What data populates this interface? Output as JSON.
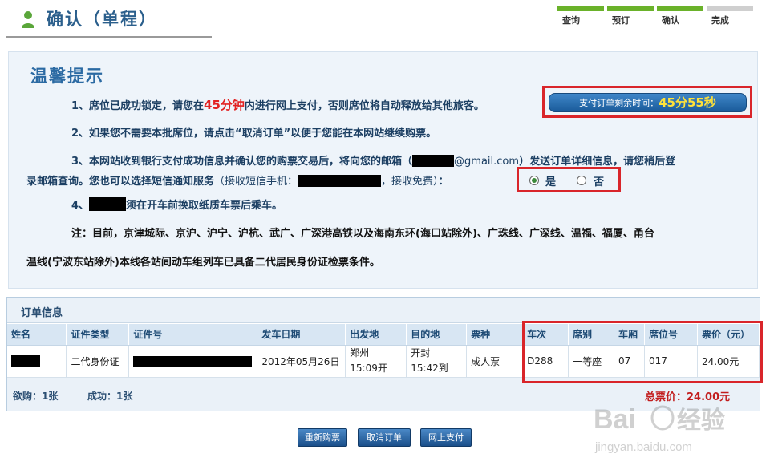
{
  "page": {
    "title": "确认（单程）"
  },
  "steps": [
    {
      "label": "查询",
      "done": true
    },
    {
      "label": "预订",
      "done": true
    },
    {
      "label": "确认",
      "done": true
    },
    {
      "label": "完成",
      "done": false
    }
  ],
  "tips": {
    "heading": "温馨提示",
    "line1_pre": "1、席位已成功锁定，请您在",
    "line1_time": "45分钟",
    "line1_post": "内进行网上支付，否则席位将自动释放给其他旅客。",
    "line2": "2、如果您不需要本批席位，请点击“取消订单”以便于您能在本网站继续购票。",
    "line3a_pre": "3、本网站收到银行支付成功信息并确认您的购票交易后，将向您的邮箱（",
    "line3a_email": "@gmail.com",
    "line3a_post": "）发送订单详细信息，请您稍后登",
    "line3b_pre": "录邮箱查询。您也可以选择短信通知服务",
    "line3b_paren_pre": "（接收短信手机：",
    "line3b_paren_post": "，接收免费）",
    "line3b_end": "：",
    "line4": "须在开车前换取纸质车票后乘车。",
    "line4_pre": "4、",
    "note1": "注：目前，京津城际、京沪、沪宁、沪杭、武广、广深港高铁以及海南东环(海口站除外)、广珠线、广深线、温福、福厦、甬台",
    "note2": "温线(宁波东站除外)本线各站间动车组列车已具备二代居民身份证检票条件。",
    "timer_label": "支付订单剩余时间：",
    "timer_value": "45分55秒",
    "sms_yes": "是",
    "sms_no": "否",
    "sms_selected": "yes"
  },
  "order": {
    "heading": "订单信息",
    "columns": [
      "姓名",
      "证件类型",
      "证件号",
      "发车日期",
      "出发地",
      "目的地",
      "票种",
      "车次",
      "席别",
      "车厢",
      "席位号",
      "票价（元）"
    ],
    "rows": [
      {
        "name": "",
        "id_type": "二代身份证",
        "id_number": "",
        "date": "2012年05月26日",
        "from_station": "郑州",
        "from_time": "15:09开",
        "to_station": "开封",
        "to_time": "15:42到",
        "ticket_type": "成人票",
        "train": "D288",
        "seat_class": "一等座",
        "car": "07",
        "seat": "017",
        "price": "24.00元"
      }
    ],
    "want_label": "欲购：1张",
    "success_label": "成功：1张",
    "total_label": "总票价：",
    "total_value": "24.00元"
  },
  "buttons": {
    "rebuy": "重新购票",
    "cancel": "取消订单",
    "pay": "网上支付"
  },
  "watermark": {
    "brand": "Bai",
    "brand_cn": "经验",
    "url": "jingyan.baidu.com"
  }
}
